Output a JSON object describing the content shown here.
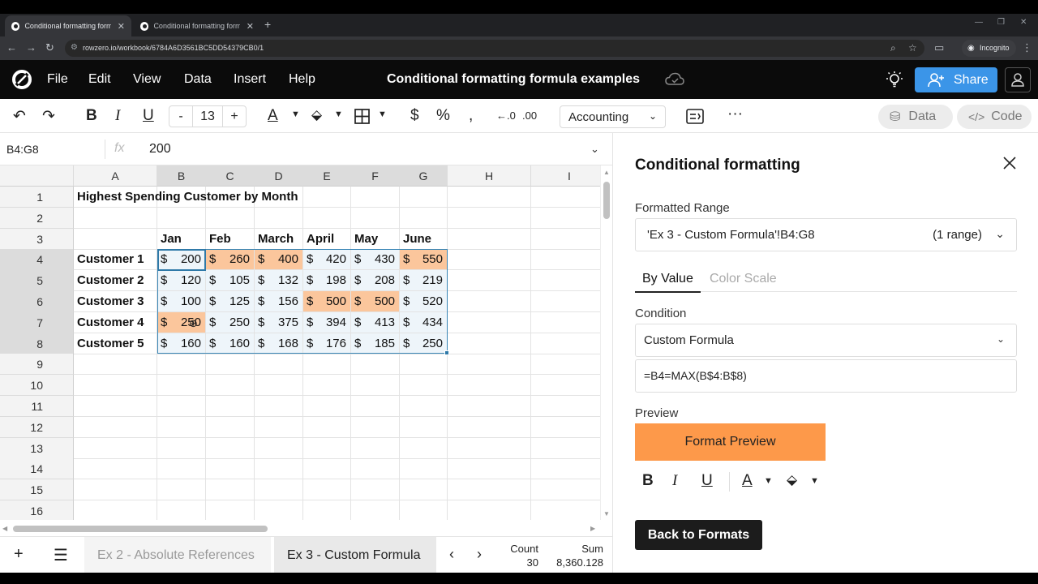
{
  "browser": {
    "tabs": [
      {
        "title": "Conditional formatting formula examples",
        "active": true
      },
      {
        "title": "Conditional formatting formula examples",
        "active": false
      }
    ],
    "url": "rowzero.io/workbook/6784A6D3561BC5DD54379CB0/1",
    "incognito_label": "Incognito"
  },
  "app": {
    "menu": [
      "File",
      "Edit",
      "View",
      "Data",
      "Insert",
      "Help"
    ],
    "title": "Conditional formatting formula examples",
    "share_label": "Share"
  },
  "toolbar": {
    "font_size": "13",
    "minus": "-",
    "plus": "+",
    "number_format": "Accounting",
    "data_label": "Data",
    "code_label": "Code",
    "more": "···"
  },
  "formula_bar": {
    "name_box": "B4:G8",
    "fx": "fx",
    "value": "200"
  },
  "grid": {
    "columns": [
      "A",
      "B",
      "C",
      "D",
      "E",
      "F",
      "G",
      "H",
      "I"
    ],
    "selected_columns": [
      "B",
      "C",
      "D",
      "E",
      "F",
      "G"
    ],
    "rows": [
      "1",
      "2",
      "3",
      "4",
      "5",
      "6",
      "7",
      "8",
      "9",
      "10",
      "11",
      "12",
      "13",
      "14",
      "15",
      "16"
    ],
    "selected_rows": [
      "4",
      "5",
      "6",
      "7",
      "8"
    ],
    "title": "Highest Spending Customer by Month",
    "months": [
      "Jan",
      "Feb",
      "March",
      "April",
      "May",
      "June"
    ],
    "currency_symbol": "$",
    "customers": [
      {
        "name": "Customer 1",
        "values": [
          "200",
          "260",
          "400",
          "420",
          "430",
          "550"
        ],
        "highlight": [
          false,
          true,
          true,
          false,
          false,
          true
        ]
      },
      {
        "name": "Customer 2",
        "values": [
          "120",
          "105",
          "132",
          "198",
          "208",
          "219"
        ],
        "highlight": [
          false,
          false,
          false,
          false,
          false,
          false
        ]
      },
      {
        "name": "Customer 3",
        "values": [
          "100",
          "125",
          "156",
          "500",
          "500",
          "520"
        ],
        "highlight": [
          false,
          false,
          false,
          true,
          true,
          false
        ]
      },
      {
        "name": "Customer 4",
        "values": [
          "250",
          "250",
          "375",
          "394",
          "413",
          "434"
        ],
        "highlight": [
          true,
          false,
          false,
          false,
          false,
          false
        ]
      },
      {
        "name": "Customer 5",
        "values": [
          "160",
          "160",
          "168",
          "176",
          "185",
          "250"
        ],
        "highlight": [
          false,
          false,
          false,
          false,
          false,
          false
        ]
      }
    ],
    "highlight_color": "#fbc69c",
    "range_fill_color": "#eef5fa"
  },
  "sheets": {
    "tabs": [
      "Ex 2 - Absolute References",
      "Ex 3 - Custom Formula"
    ],
    "active": "Ex 3 - Custom Formula",
    "count_label": "Count",
    "count_value": "30",
    "sum_label": "Sum",
    "sum_value": "8,360.128"
  },
  "panel": {
    "title": "Conditional formatting",
    "range_label": "Formatted Range",
    "range_value": "'Ex 3 - Custom Formula'!B4:G8",
    "range_count": "(1 range)",
    "tab_by_value": "By Value",
    "tab_color_scale": "Color Scale",
    "condition_label": "Condition",
    "condition_value": "Custom Formula",
    "formula": "=B4=MAX(B$4:B$8)",
    "preview_label": "Preview",
    "preview_text": "Format Preview",
    "preview_color": "#fd994a",
    "back_button": "Back to Formats"
  }
}
